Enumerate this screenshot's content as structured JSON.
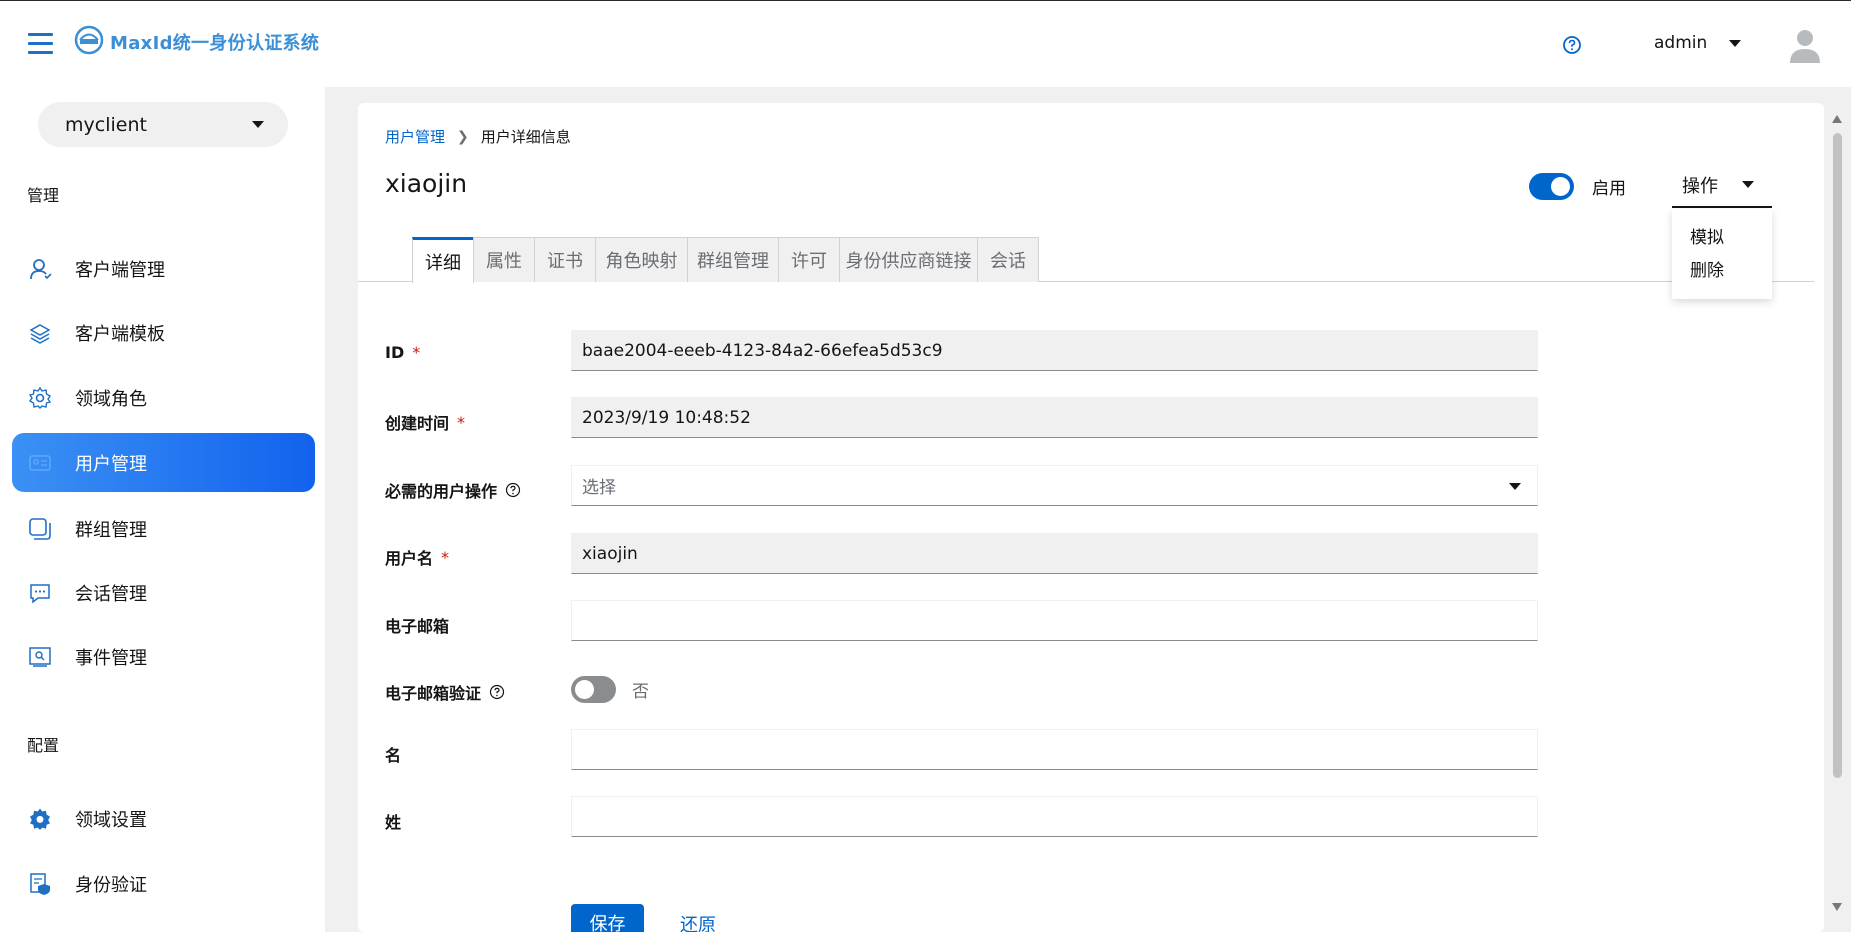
{
  "header": {
    "app_title": "MaxId统一身份认证系统",
    "username": "admin"
  },
  "sidebar": {
    "client_select": "myclient",
    "section_manage": "管理",
    "section_config": "配置",
    "items": [
      {
        "label": "客户端管理",
        "icon": "user-icon"
      },
      {
        "label": "客户端模板",
        "icon": "layers-icon"
      },
      {
        "label": "领域角色",
        "icon": "gear-outline-icon"
      },
      {
        "label": "用户管理",
        "icon": "id-card-icon",
        "active": true
      },
      {
        "label": "群组管理",
        "icon": "group-icon"
      },
      {
        "label": "会话管理",
        "icon": "chat-icon"
      },
      {
        "label": "事件管理",
        "icon": "event-icon"
      }
    ],
    "config_items": [
      {
        "label": "领域设置",
        "icon": "gear-filled-icon"
      },
      {
        "label": "身份验证",
        "icon": "shield-doc-icon"
      }
    ]
  },
  "breadcrumb": {
    "parent": "用户管理",
    "current": "用户详细信息"
  },
  "page": {
    "title": "xiaojin",
    "enabled_label": "启用",
    "enabled": true,
    "actions_label": "操作",
    "actions_menu": [
      "模拟",
      "删除"
    ]
  },
  "tabs": [
    "详细",
    "属性",
    "证书",
    "角色映射",
    "群组管理",
    "许可",
    "身份供应商链接",
    "会话"
  ],
  "form": {
    "id_label": "ID",
    "id_value": "baae2004-eeeb-4123-84a2-66efea5d53c9",
    "created_label": "创建时间",
    "created_value": "2023/9/19 10:48:52",
    "required_actions_label": "必需的用户操作",
    "required_actions_placeholder": "选择",
    "username_label": "用户名",
    "username_value": "xiaojin",
    "email_label": "电子邮箱",
    "email_value": "",
    "email_verified_label": "电子邮箱验证",
    "email_verified_value": "否",
    "first_name_label": "名",
    "first_name_value": "",
    "last_name_label": "姓",
    "last_name_value": "",
    "save_label": "保存",
    "reset_label": "还原"
  },
  "colors": {
    "primary": "#0066cc",
    "active_nav_start": "#3b91f4",
    "active_nav_end": "#1262ee",
    "required": "#c9190b"
  }
}
